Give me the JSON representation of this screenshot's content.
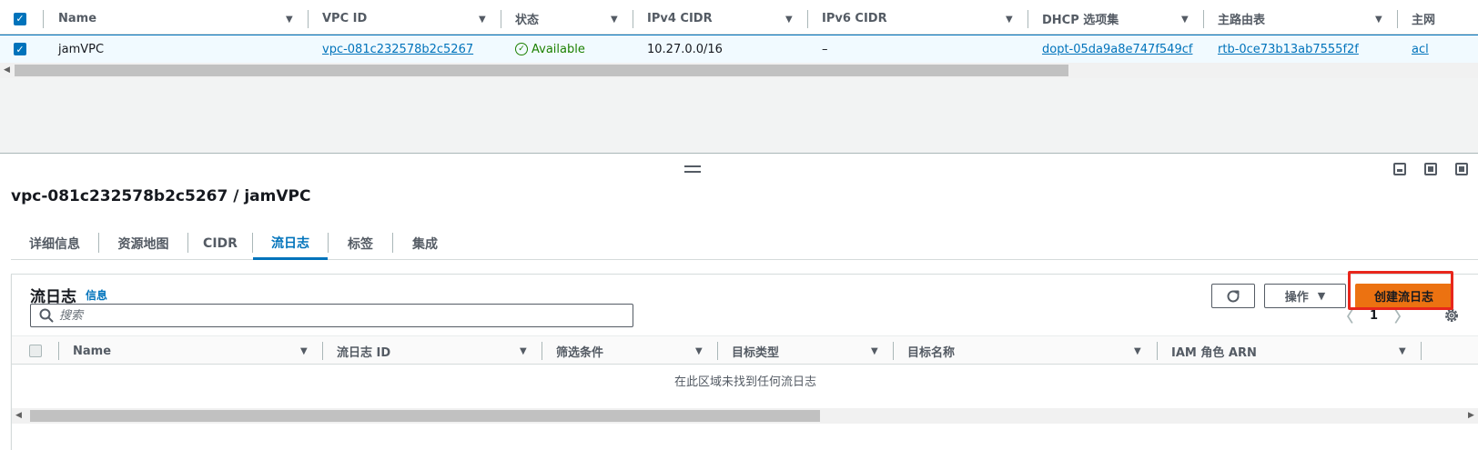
{
  "vpc_table": {
    "columns": [
      {
        "label": "Name"
      },
      {
        "label": "VPC ID"
      },
      {
        "label": "状态"
      },
      {
        "label": "IPv4 CIDR"
      },
      {
        "label": "IPv6 CIDR"
      },
      {
        "label": "DHCP 选项集"
      },
      {
        "label": "主路由表"
      },
      {
        "label": "主网"
      }
    ],
    "row": {
      "name": "jamVPC",
      "vpc_id": "vpc-081c232578b2c5267",
      "state": "Available",
      "ipv4_cidr": "10.27.0.0/16",
      "ipv6_cidr": "–",
      "dhcp_options": "dopt-05da9a8e747f549cf",
      "main_route_table": "rtb-0ce73b13ab7555f2f",
      "main_acl": "acl"
    }
  },
  "detail": {
    "title": "vpc-081c232578b2c5267 / jamVPC",
    "tabs": [
      {
        "label": "详细信息"
      },
      {
        "label": "资源地图"
      },
      {
        "label": "CIDR"
      },
      {
        "label": "流日志"
      },
      {
        "label": "标签"
      },
      {
        "label": "集成"
      }
    ],
    "active_tab": "流日志"
  },
  "flow_logs": {
    "title": "流日志",
    "info_link": "信息",
    "actions_label": "操作",
    "create_label": "创建流日志",
    "search_placeholder": "搜索",
    "page_number": "1",
    "columns": [
      {
        "label": "Name"
      },
      {
        "label": "流日志 ID"
      },
      {
        "label": "筛选条件"
      },
      {
        "label": "目标类型"
      },
      {
        "label": "目标名称"
      },
      {
        "label": "IAM 角色 ARN"
      }
    ],
    "empty_message": "在此区域未找到任何流日志"
  },
  "colors": {
    "accent": "#0073bb",
    "primary_button": "#ec7211",
    "success": "#1d8102",
    "highlight": "#e8261c"
  }
}
